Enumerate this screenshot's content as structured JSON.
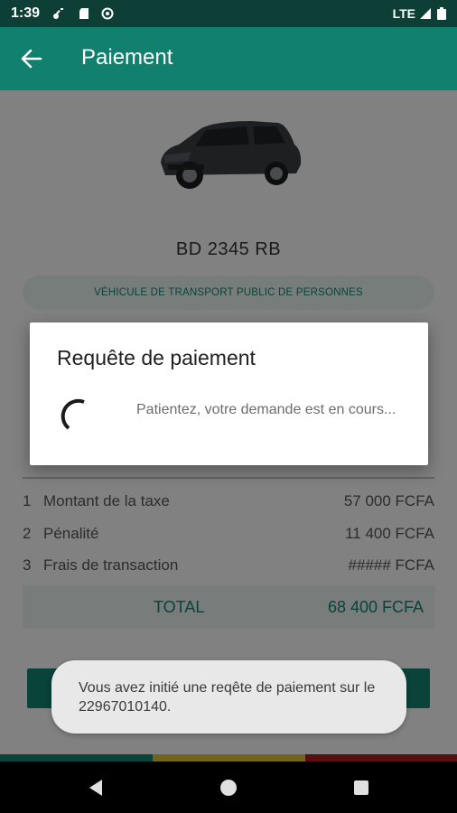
{
  "status_bar": {
    "time": "1:39",
    "network": "LTE",
    "icons": [
      "key-icon",
      "sd-card-icon",
      "sync-icon",
      "signal-icon",
      "battery-icon"
    ]
  },
  "app_bar": {
    "title": "Paiement",
    "back_icon": "arrow-left-icon"
  },
  "vehicle": {
    "plate": "BD 2345 RB",
    "type": "VÉHICULE DE TRANSPORT PUBLIC DE PERSONNES"
  },
  "fees": {
    "rows": [
      {
        "num": "1",
        "label": "Montant de la taxe",
        "amount": "57 000 FCFA"
      },
      {
        "num": "2",
        "label": "Pénalité",
        "amount": "11 400 FCFA"
      },
      {
        "num": "3",
        "label": "Frais de transaction",
        "amount": "##### FCFA"
      }
    ],
    "total_label": "TOTAL",
    "total_amount": "68 400 FCFA"
  },
  "dialog": {
    "title": "Requête de paiement",
    "message": "Patientez, votre demande est en cours..."
  },
  "toast": {
    "message": "Vous avez initié une reqête de paiement sur le 22967010140."
  },
  "colors": {
    "primary": "#12806f",
    "status_bar": "#0d3f36",
    "flag_green": "#12806f",
    "flag_yellow": "#d8c13a",
    "flag_red": "#a31e22"
  }
}
